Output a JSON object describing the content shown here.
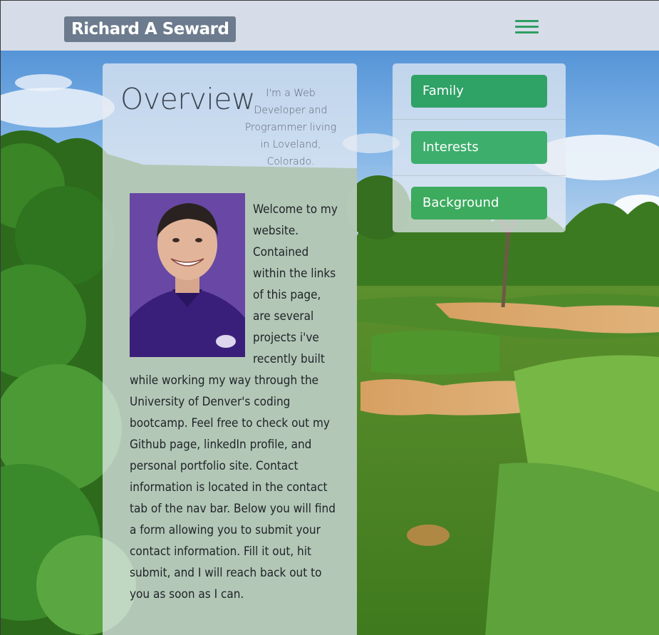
{
  "navbar": {
    "brand": "Richard A Seward",
    "menu_icon": "hamburger-menu-icon"
  },
  "overview": {
    "title": "Overview",
    "tagline": "I'm a Web Developer and Programmer living in Loveland, Colorado.",
    "photo_icon": "profile-photo",
    "welcome_text": "Welcome to my website. Contained within the links of this page, are several projects i've recently built while working my way through the University of Denver's coding bootcamp. Feel free to check out my Github page, linkedIn profile, and personal portfolio site. Contact information is located in the contact tab of the nav bar. Below you will find a form allowing you to submit your contact information. Fill it out, hit submit, and I will reach back out to you as soon as I can."
  },
  "links": [
    {
      "label": "Family",
      "color": "#2fa266"
    },
    {
      "label": "Interests",
      "color": "#3dae6c"
    },
    {
      "label": "Background",
      "color": "#3cab5e"
    }
  ],
  "colors": {
    "navbar_bg": "#d7dde8",
    "brand_bg": "#6c7b8d",
    "accent_green": "#2f9e63",
    "card_bg": "#e8ecf2"
  }
}
